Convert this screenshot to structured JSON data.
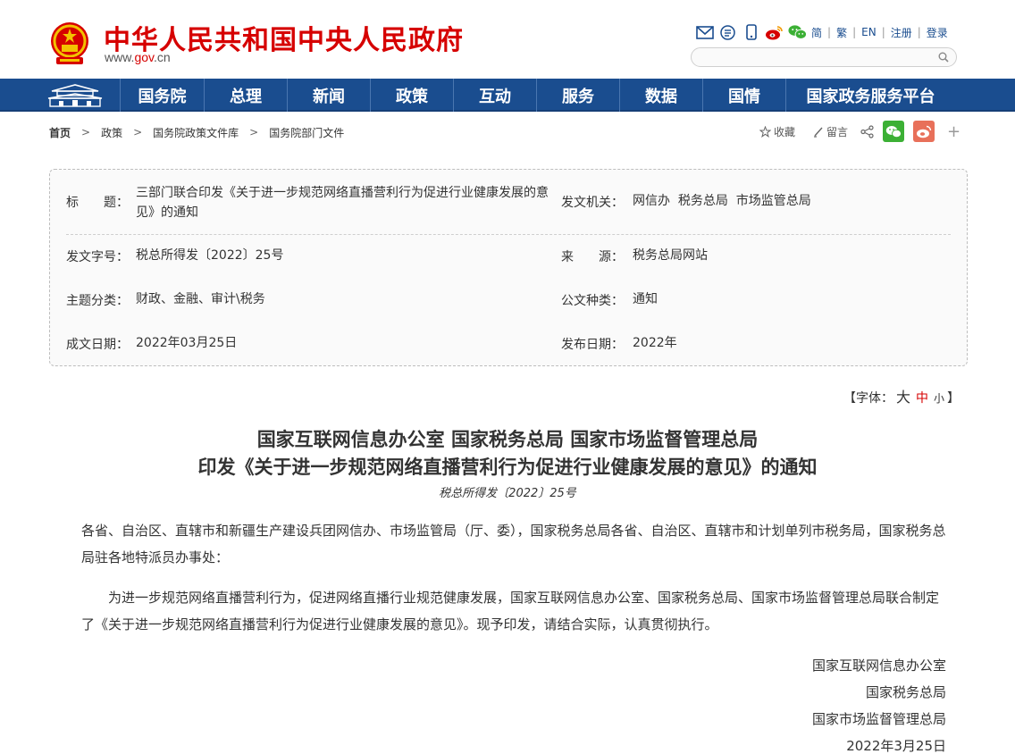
{
  "header": {
    "site_title": "中华人民共和国中央人民政府",
    "url_prefix": "www.",
    "url_gov": "gov",
    "url_suffix": ".cn",
    "tools": {
      "icons": [
        "mail-icon",
        "rss-icon",
        "mobile-icon",
        "weibo-icon",
        "wechat-icon"
      ],
      "links": [
        "简",
        "繁",
        "EN",
        "注册",
        "登录"
      ]
    },
    "search": {
      "placeholder": ""
    }
  },
  "nav": {
    "items": [
      "国务院",
      "总理",
      "新闻",
      "政策",
      "互动",
      "服务",
      "数据",
      "国情",
      "国家政务服务平台"
    ]
  },
  "breadcrumb": {
    "items": [
      "首页",
      "政策",
      "国务院政策文件库",
      "国务院部门文件"
    ],
    "arrow": ">"
  },
  "share": {
    "collect": "收藏",
    "comment": "留言",
    "plus": "+"
  },
  "info": {
    "title_label": "标　　题：",
    "title_value": "三部门联合印发《关于进一步规范网络直播营利行为促进行业健康发展的意见》的通知",
    "issuer_label": "发文机关：",
    "issuer_value": "网信办  税务总局  市场监管总局",
    "docno_label": "发文字号：",
    "docno_value": "税总所得发〔2022〕25号",
    "source_label": "来　　源：",
    "source_value": "税务总局网站",
    "topic_label": "主题分类：",
    "topic_value": "财政、金融、审计\\税务",
    "type_label": "公文种类：",
    "type_value": "通知",
    "written_label": "成文日期：",
    "written_value": "2022年03月25日",
    "published_label": "发布日期：",
    "published_value": "2022年"
  },
  "fontsize": {
    "prefix": "【字体：",
    "large": "大",
    "medium": "中",
    "small": "小",
    "suffix": "】"
  },
  "article": {
    "title_line1": "国家互联网信息办公室 国家税务总局 国家市场监督管理总局",
    "title_line2": "印发《关于进一步规范网络直播营利行为促进行业健康发展的意见》的通知",
    "docno": "税总所得发〔2022〕25号",
    "recipients": "各省、自治区、直辖市和新疆生产建设兵团网信办、市场监管局（厅、委），国家税务总局各省、自治区、直辖市和计划单列市税务局，国家税务总局驻各地特派员办事处：",
    "body": "　　为进一步规范网络直播营利行为，促进网络直播行业规范健康发展，国家互联网信息办公室、国家税务总局、国家市场监督管理总局联合制定了《关于进一步规范网络直播营利行为促进行业健康发展的意见》。现予印发，请结合实际，认真贯彻执行。",
    "signers": [
      "国家互联网信息办公室",
      "国家税务总局",
      "国家市场监督管理总局"
    ],
    "date": "2022年3月25日"
  },
  "colors": {
    "brand_red": "#d60000",
    "nav_blue": "#1a4d8f"
  }
}
